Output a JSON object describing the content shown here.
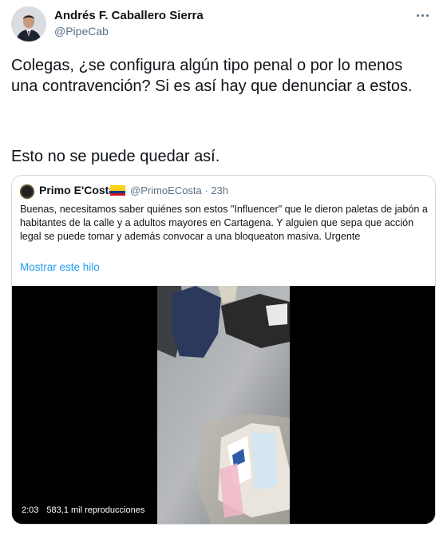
{
  "author": {
    "name": "Andrés F. Caballero Sierra",
    "handle": "@PipeCab",
    "avatar_icon": "profile-photo"
  },
  "more_icon": "ellipsis-icon",
  "tweet": {
    "text_1": "Colegas, ¿se configura algún tipo penal o por lo menos\nuna contravención? Si es así hay que denunciar a estos.",
    "text_2": "Esto no se puede quedar así."
  },
  "quoted": {
    "name": "Primo E'Costa",
    "flag_icon": "colombia-flag-icon",
    "meta": "@PrimoECosta · 23h",
    "text": "Buenas, necesitamos saber quiénes son estos \"Influencer\" que le dieron paletas de jabón a habitantes de la calle y a adultos mayores en Cartagena. Y alguien que sepa que acción legal se puede tomar y además convocar a una bloqueaton masiva. Urgente",
    "show_thread": "Mostrar este hilo",
    "video": {
      "duration": "2:03",
      "views": "583,1 mil reproducciones"
    }
  },
  "colors": {
    "text": "#0f1419",
    "secondary": "#5b7083",
    "link": "#1d9bf0",
    "border": "#cfd9de"
  }
}
